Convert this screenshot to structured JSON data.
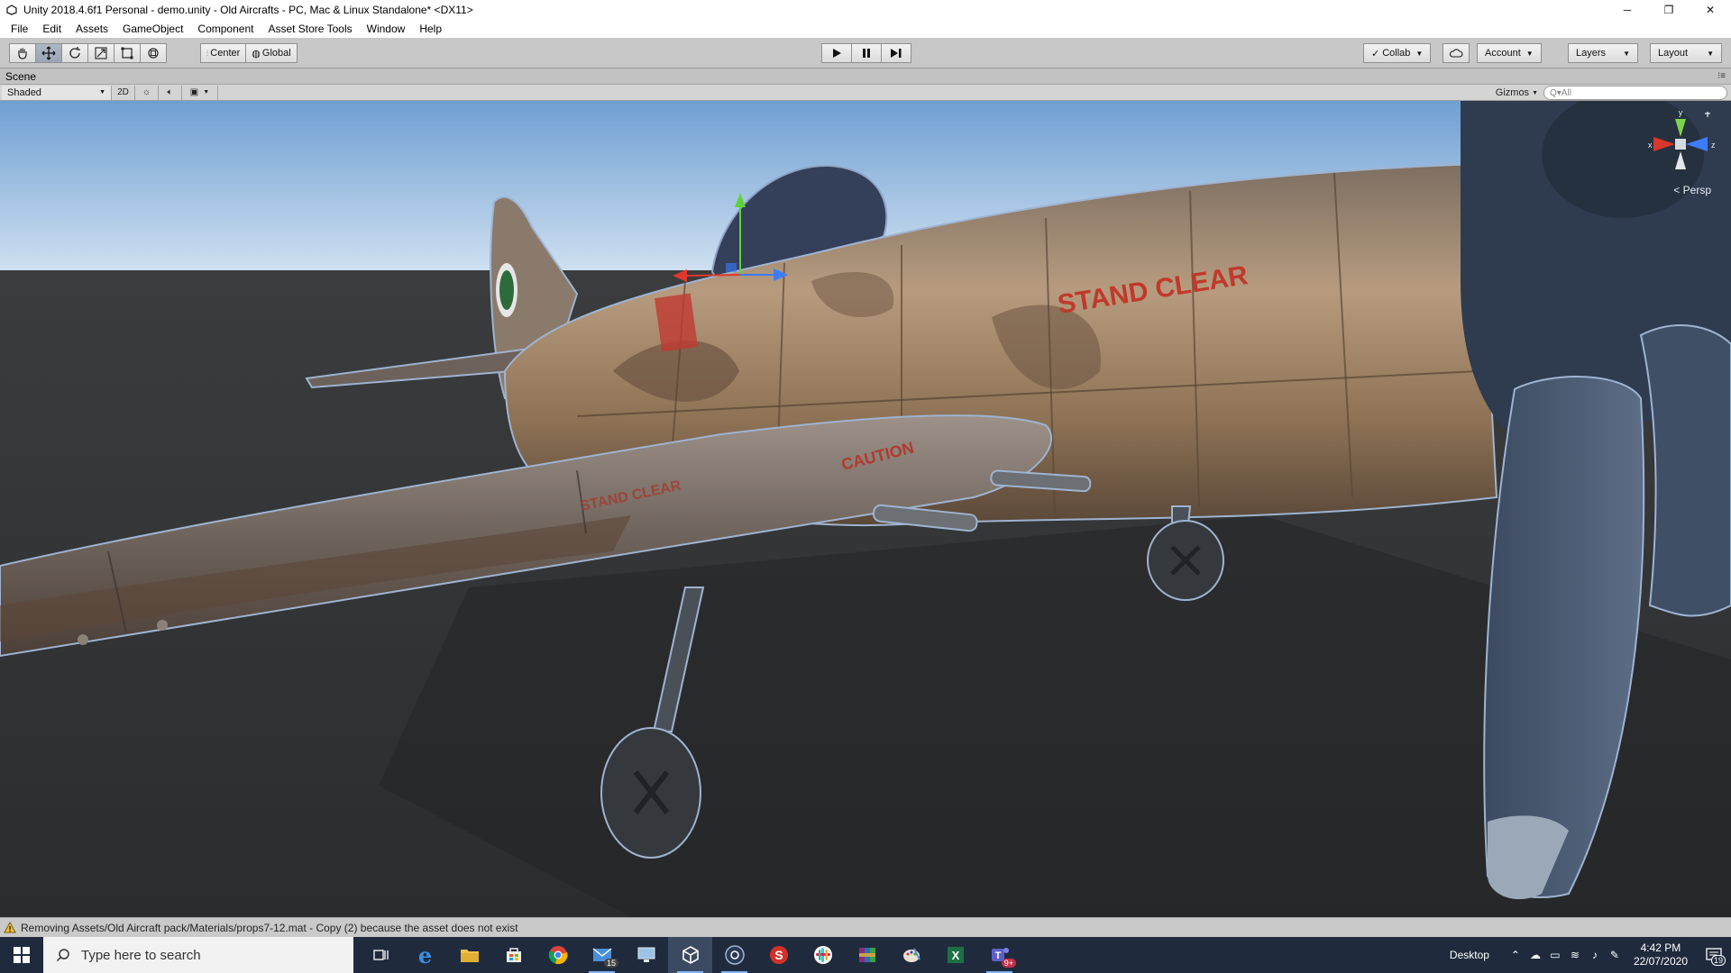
{
  "window": {
    "title": "Unity 2018.4.6f1 Personal - demo.unity - Old Aircrafts - PC, Mac & Linux Standalone* <DX11>",
    "controls": [
      "─",
      "❐",
      "✕"
    ]
  },
  "menubar": {
    "items": [
      "File",
      "Edit",
      "Assets",
      "GameObject",
      "Component",
      "Asset Store Tools",
      "Window",
      "Help"
    ]
  },
  "toolbar": {
    "transform_tools": [
      "hand-icon",
      "move-icon",
      "rotate-icon",
      "scale-icon",
      "rect-icon",
      "transform-icon"
    ],
    "pivot": "Center",
    "space": "Global",
    "play_controls": [
      "play-icon",
      "pause-icon",
      "step-icon"
    ],
    "collab": "Collab",
    "account": "Account",
    "layers": "Layers",
    "layout": "Layout"
  },
  "scene": {
    "tab": "Scene",
    "draw_mode": "Shaded",
    "mode_2d": "2D",
    "gizmos": "Gizmos",
    "search_placeholder": "Q▾All",
    "persp": "< Persp",
    "axis_labels": {
      "x": "x",
      "y": "y",
      "z": "z"
    },
    "fuselage_text": "STAND CLEAR",
    "wing_text_1": "CAUTION",
    "wing_text_2": "STAND CLEAR"
  },
  "status": {
    "message": "Removing Assets/Old Aircraft pack/Materials/props7-12.mat - Copy (2) because the asset does not exist"
  },
  "taskbar": {
    "search_placeholder": "Type here to search",
    "mail_badge": "15",
    "teams_badge": "9+",
    "desktop_label": "Desktop",
    "time": "4:42 PM",
    "date": "22/07/2020",
    "notification_count": "19"
  },
  "colors": {
    "sky_top": "#7aa7d6",
    "ground": "#2e3032",
    "fuselage": "#a08466",
    "decal_red": "#c03a32",
    "taskbar": "#1f2b3d"
  }
}
